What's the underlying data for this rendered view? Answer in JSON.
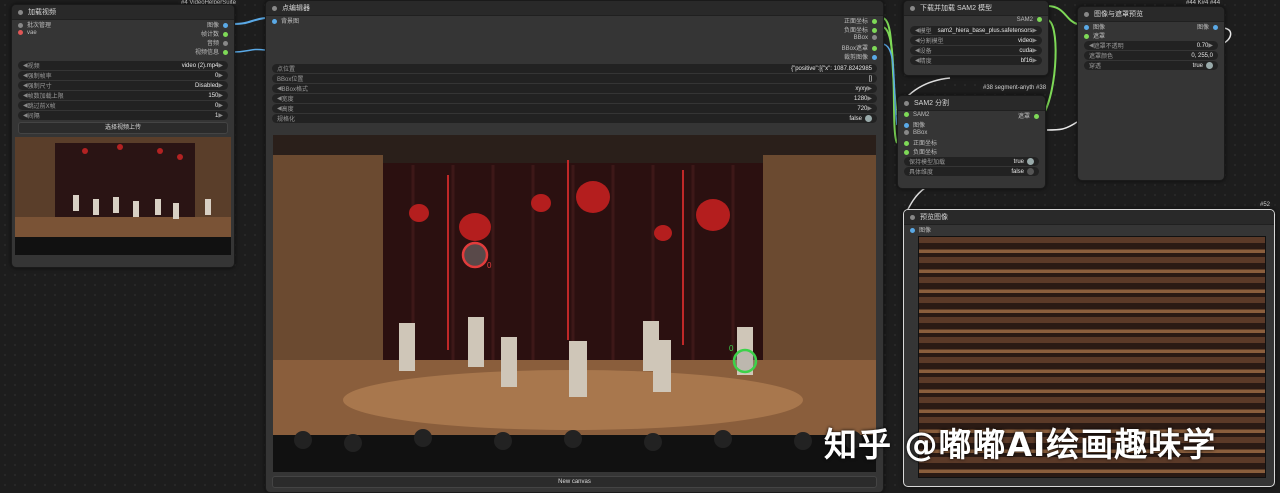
{
  "top_badges": {
    "load_video": "#4 VideoHelperSuite",
    "right": "#44 K#4 #44"
  },
  "load_video": {
    "title": "加载视频",
    "outputs": [
      "图像",
      "帧计数",
      "音频",
      "视频信息"
    ],
    "inputs": [
      "批次管理",
      "vae"
    ],
    "widgets": [
      {
        "label": "视频",
        "value": "video (2).mp4"
      },
      {
        "label": "强制帧率",
        "value": "0"
      },
      {
        "label": "强制尺寸",
        "value": "Disabled"
      },
      {
        "label": "帧数加载上限",
        "value": "150"
      },
      {
        "label": "跳过前X帧",
        "value": "0"
      },
      {
        "label": "间隔",
        "value": "1"
      }
    ],
    "upload_button": "选择视频上传"
  },
  "points_editor": {
    "title": "点编辑器",
    "input": "背景图",
    "outputs": [
      "正面坐标",
      "负面坐标",
      "BBox",
      "BBox遮罩",
      "裁剪图像"
    ],
    "widgets": [
      {
        "label": "点位置",
        "value": "{\"positive\":[{\"x\": 1087.8242985"
      },
      {
        "label": "BBox位置",
        "value": "[]"
      },
      {
        "label": "BBox格式",
        "value": "xyxy"
      },
      {
        "label": "宽度",
        "value": "1280"
      },
      {
        "label": "高度",
        "value": "720"
      },
      {
        "label": "规格化",
        "value": "false"
      }
    ],
    "new_canvas": "New canvas",
    "point_labels": [
      "0",
      "0"
    ]
  },
  "sam2_loader": {
    "title": "下载并加载 SAM2 模型",
    "output": "SAM2",
    "widgets": [
      {
        "label": "模型",
        "value": "sam2_hiera_base_plus.safetensors"
      },
      {
        "label": "分割模型",
        "value": "video"
      },
      {
        "label": "设备",
        "value": "cuda"
      },
      {
        "label": "精度",
        "value": "bf16"
      }
    ]
  },
  "sam2_segment": {
    "title": "SAM2 分割",
    "badge": "#38 segment-anyth #38",
    "inputs": [
      "SAM2",
      "图像",
      "BBox",
      "正面坐标",
      "负面坐标"
    ],
    "output": "遮罩",
    "widgets": [
      {
        "label": "保持模型加载",
        "value": "true"
      },
      {
        "label": "具体维度",
        "value": "false"
      }
    ]
  },
  "image_mask_preview": {
    "title": "图像与遮罩预览",
    "inputs": [
      "图像",
      "遮罩"
    ],
    "output": "图像",
    "widgets": [
      {
        "label": "遮罩不透明",
        "value": "0.70"
      },
      {
        "label": "遮罩颜色",
        "value": "0, 255,0"
      },
      {
        "label": "穿透",
        "value": "true"
      }
    ]
  },
  "preview_image": {
    "title": "预览图像",
    "input": "图像",
    "badge": "#52"
  },
  "watermark": "知乎 @嘟嘟AI绘画趣味学",
  "colors": {
    "node_bg": "#353535",
    "header_bg": "#292929",
    "canvas_bg": "#1d1d1d",
    "wire_green": "#7ed957",
    "wire_blue": "#5aa9e6",
    "point_red": "#e23c3c",
    "point_green": "#3cd24a"
  }
}
